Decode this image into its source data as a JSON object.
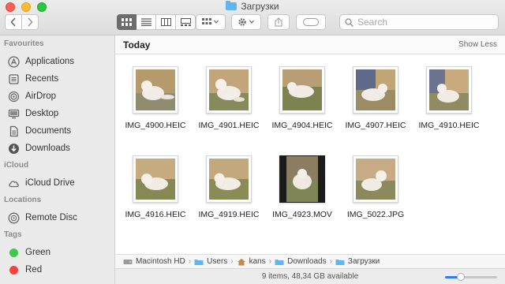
{
  "window": {
    "title": "Загрузки"
  },
  "search": {
    "placeholder": "Search"
  },
  "sidebar": {
    "sections": [
      {
        "header": "Favourites",
        "items": [
          {
            "label": "Applications",
            "icon": "applications-icon"
          },
          {
            "label": "Recents",
            "icon": "recents-icon"
          },
          {
            "label": "AirDrop",
            "icon": "airdrop-icon"
          },
          {
            "label": "Desktop",
            "icon": "desktop-icon"
          },
          {
            "label": "Documents",
            "icon": "documents-icon"
          },
          {
            "label": "Downloads",
            "icon": "downloads-icon"
          }
        ]
      },
      {
        "header": "iCloud",
        "items": [
          {
            "label": "iCloud Drive",
            "icon": "icloud-drive-icon"
          }
        ]
      },
      {
        "header": "Locations",
        "items": [
          {
            "label": "Remote Disc",
            "icon": "remote-disc-icon"
          }
        ]
      },
      {
        "header": "Tags",
        "items": [
          {
            "label": "Green",
            "icon": "green-tag-icon",
            "color": "#3ec94c"
          },
          {
            "label": "Red",
            "icon": "red-tag-icon",
            "color": "#f2443c"
          }
        ]
      }
    ]
  },
  "main": {
    "section_title": "Today",
    "show_less": "Show Less",
    "files": [
      {
        "name": "IMG_4900.HEIC",
        "kind": "photo"
      },
      {
        "name": "IMG_4901.HEIC",
        "kind": "photo"
      },
      {
        "name": "IMG_4904.HEIC",
        "kind": "photo"
      },
      {
        "name": "IMG_4907.HEIC",
        "kind": "photo"
      },
      {
        "name": "IMG_4910.HEIC",
        "kind": "photo"
      },
      {
        "name": "IMG_4916.HEIC",
        "kind": "photo"
      },
      {
        "name": "IMG_4919.HEIC",
        "kind": "photo"
      },
      {
        "name": "IMG_4923.MOV",
        "kind": "video"
      },
      {
        "name": "IMG_5022.JPG",
        "kind": "photo"
      }
    ]
  },
  "pathbar": {
    "crumbs": [
      {
        "label": "Macintosh HD",
        "icon": "hard-drive-icon"
      },
      {
        "label": "Users",
        "icon": "folder-icon"
      },
      {
        "label": "kans",
        "icon": "home-icon"
      },
      {
        "label": "Downloads",
        "icon": "folder-icon"
      },
      {
        "label": "Загрузки",
        "icon": "folder-icon"
      }
    ]
  },
  "status": {
    "text": "9 items, 48,34 GB available",
    "icon_size_level": 0.3
  },
  "colors": {
    "accent": "#2d7cf6",
    "folder": "#5fb6f2",
    "sidebar_bg": "#eaeaea"
  }
}
